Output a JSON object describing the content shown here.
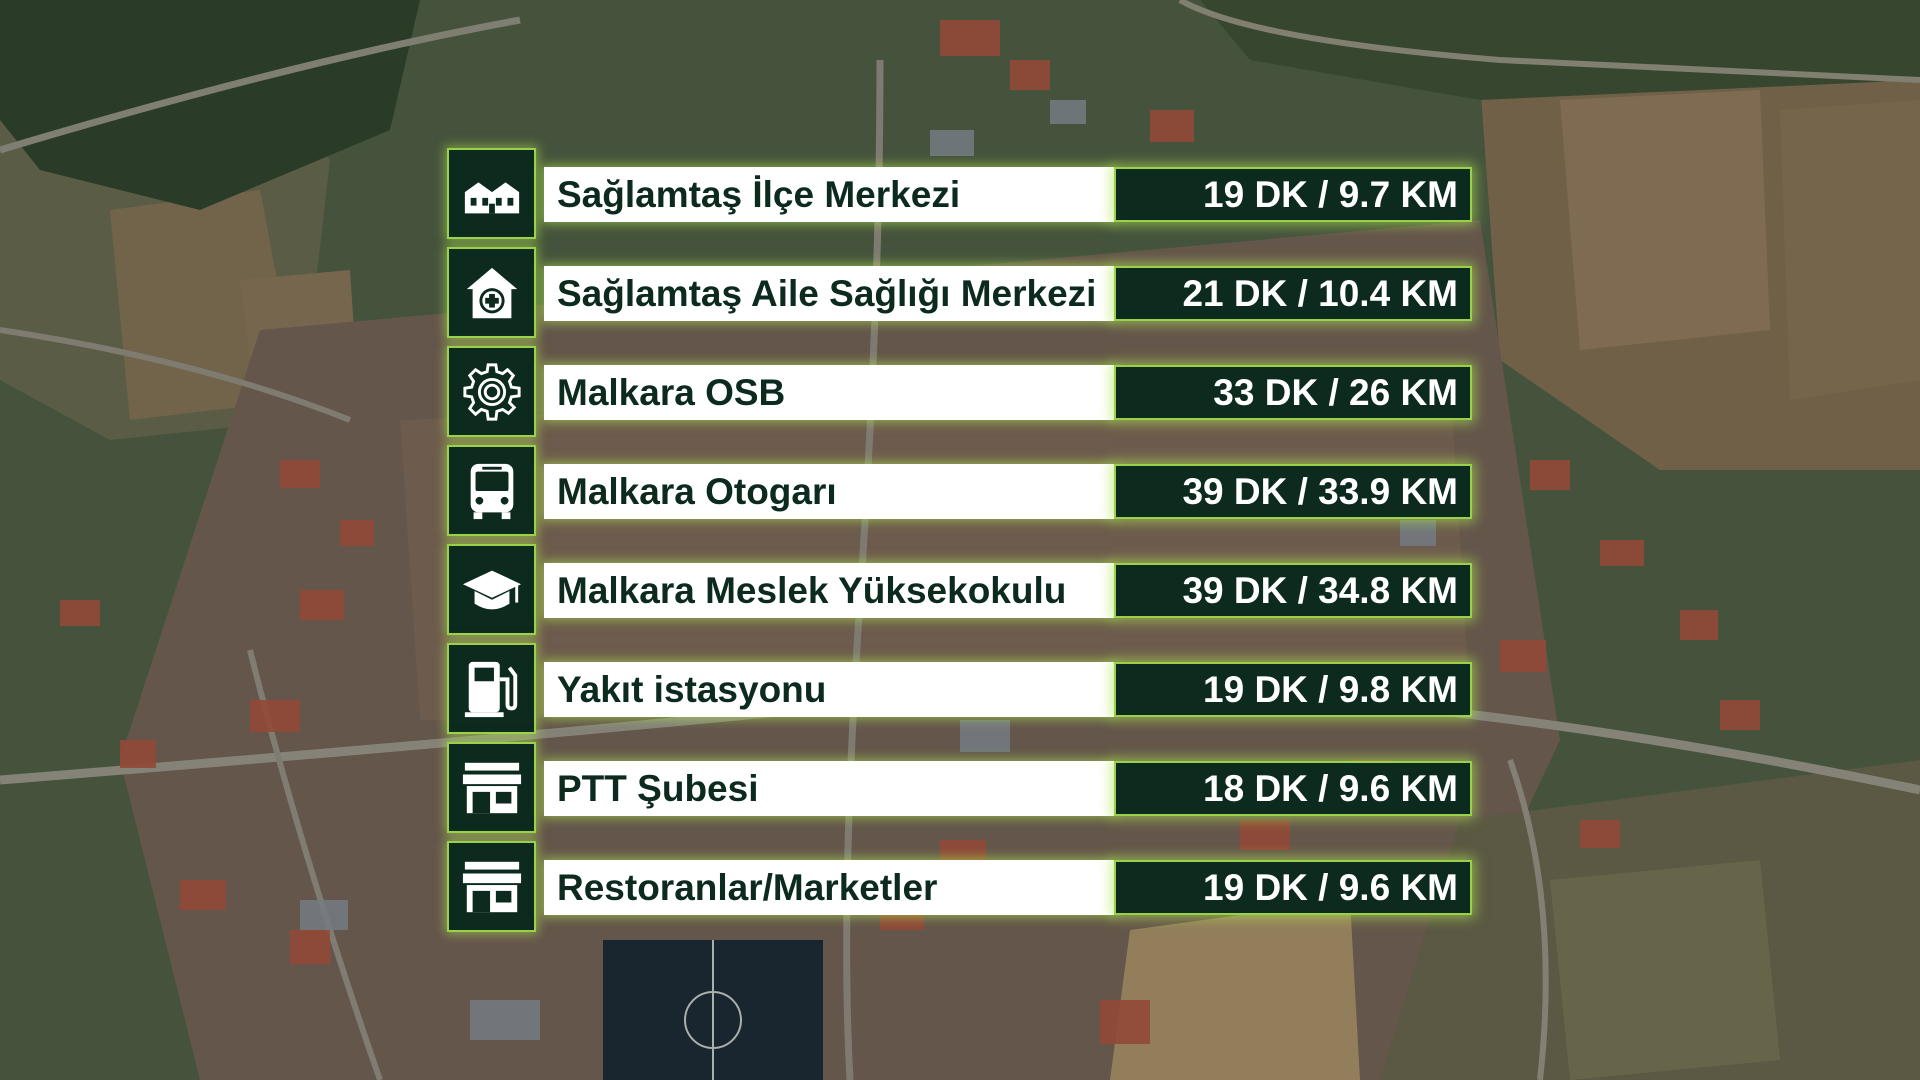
{
  "colors": {
    "dark_green": "#0c2a1e",
    "glow_green": "#9ad14a",
    "label_bg": "#ffffff",
    "value_text": "#ffffff"
  },
  "items": [
    {
      "icon": "town-buildings-icon",
      "label": "Sağlamtaş İlçe Merkezi",
      "value": "19 DK / 9.7 KM"
    },
    {
      "icon": "health-house-icon",
      "label": "Sağlamtaş Aile Sağlığı Merkezi",
      "value": "21 DK / 10.4 KM"
    },
    {
      "icon": "gear-icon",
      "label": "Malkara OSB",
      "value": "33 DK / 26 KM"
    },
    {
      "icon": "bus-icon",
      "label": "Malkara Otogarı",
      "value": "39 DK / 33.9 KM"
    },
    {
      "icon": "graduation-cap-icon",
      "label": "Malkara Meslek Yüksekokulu",
      "value": "39 DK / 34.8 KM"
    },
    {
      "icon": "fuel-pump-icon",
      "label": "Yakıt istasyonu",
      "value": "19 DK / 9.8 KM"
    },
    {
      "icon": "store-icon",
      "label": "PTT Şubesi",
      "value": "18 DK / 9.6 KM"
    },
    {
      "icon": "store-icon",
      "label": "Restoranlar/Marketler",
      "value": "19 DK / 9.6 KM"
    }
  ]
}
